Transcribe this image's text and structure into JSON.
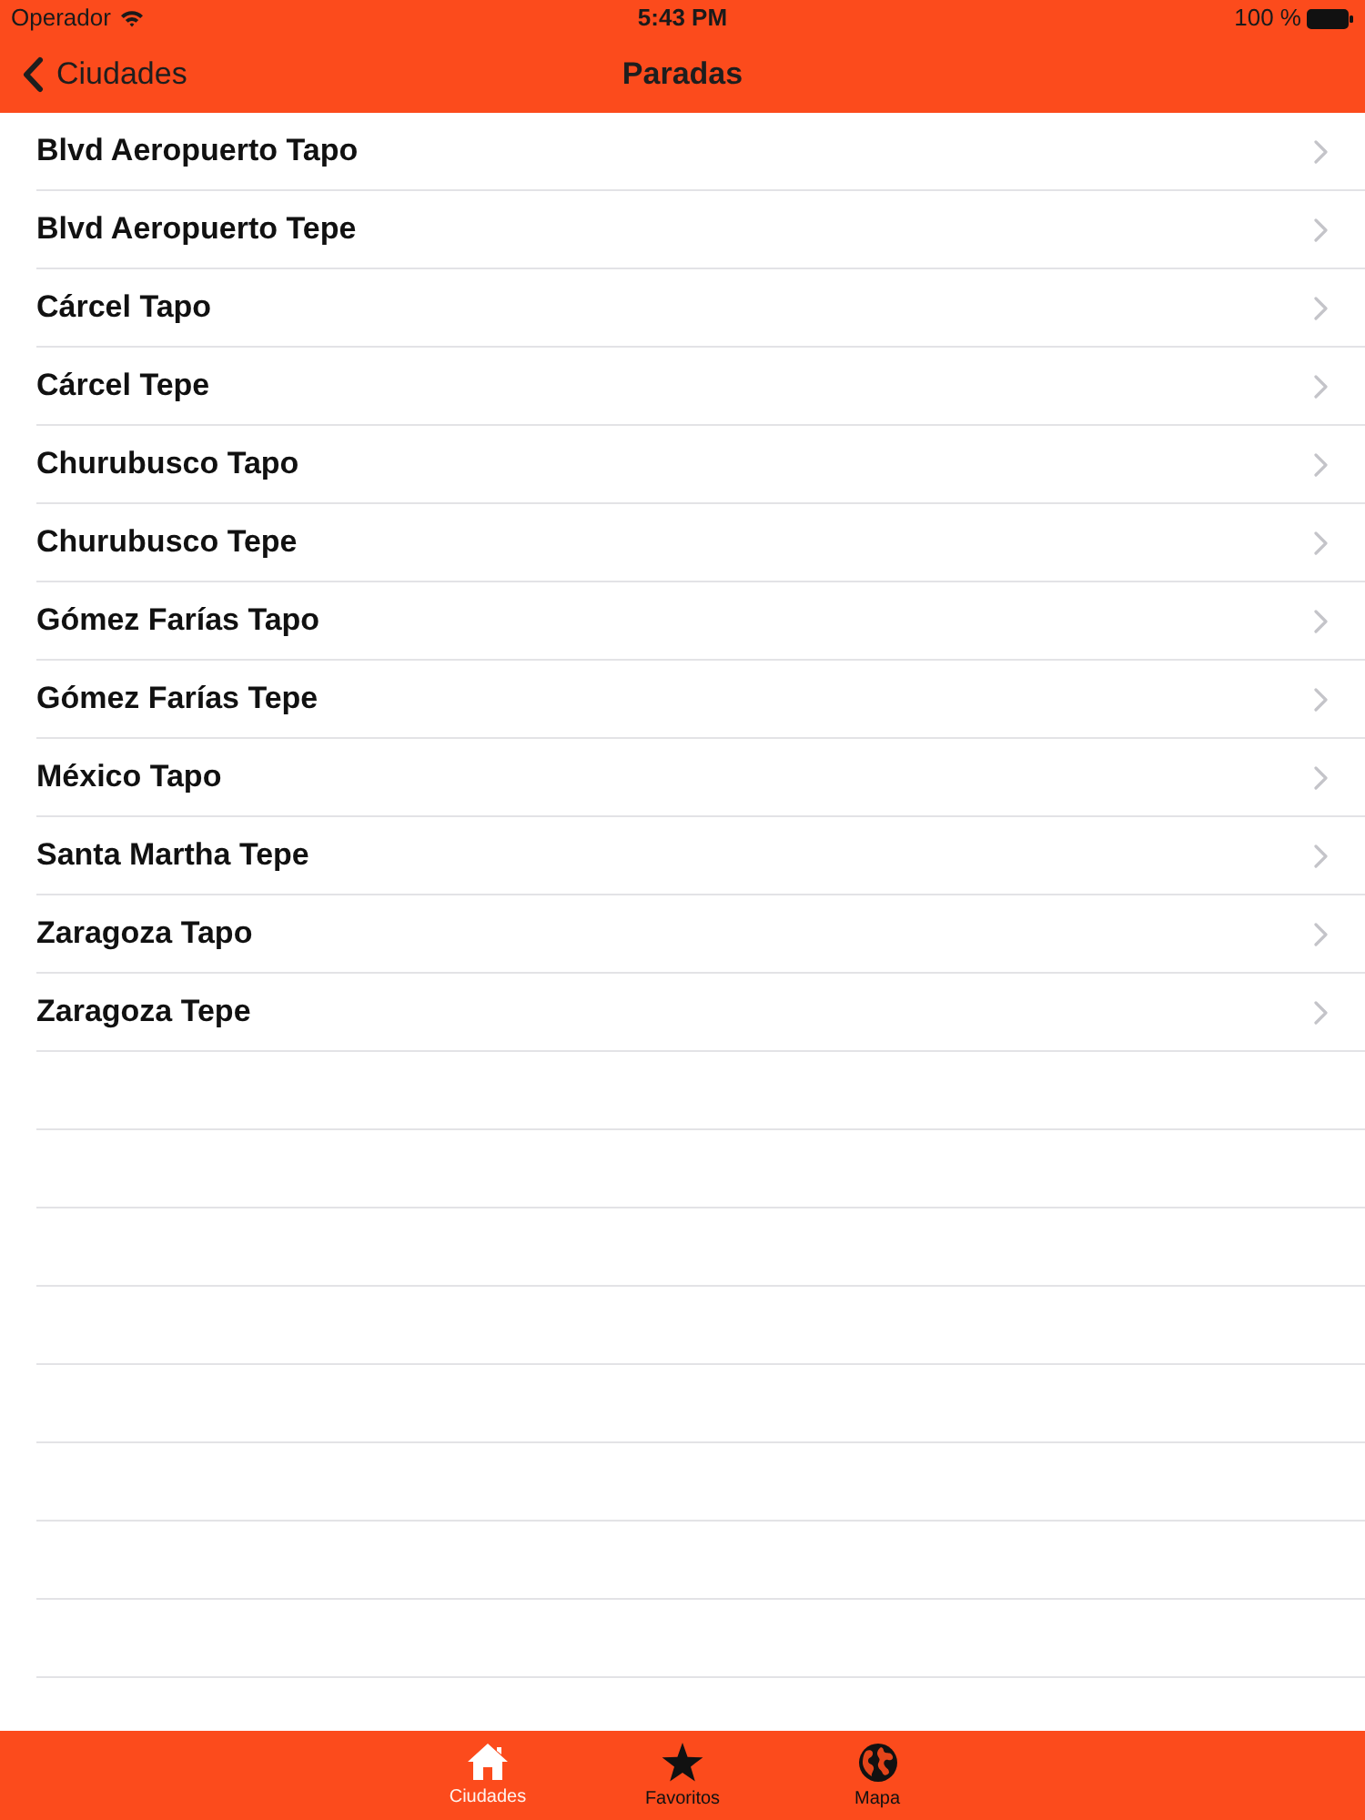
{
  "status_bar": {
    "carrier": "Operador",
    "time": "5:43 PM",
    "battery": "100 %"
  },
  "nav_bar": {
    "back": "Ciudades",
    "title": "Paradas"
  },
  "stops": [
    {
      "label": "Blvd Aeropuerto Tapo"
    },
    {
      "label": "Blvd Aeropuerto Tepe"
    },
    {
      "label": "Cárcel Tapo"
    },
    {
      "label": "Cárcel Tepe"
    },
    {
      "label": "Churubusco Tapo"
    },
    {
      "label": "Churubusco Tepe"
    },
    {
      "label": "Gómez Farías Tapo"
    },
    {
      "label": "Gómez Farías Tepe"
    },
    {
      "label": "México Tapo"
    },
    {
      "label": "Santa Martha Tepe"
    },
    {
      "label": "Zaragoza Tapo"
    },
    {
      "label": "Zaragoza Tepe"
    }
  ],
  "tab_bar": [
    {
      "label": "Ciudades",
      "selected": true
    },
    {
      "label": "Favoritos",
      "selected": false
    },
    {
      "label": "Mapa",
      "selected": false
    }
  ]
}
